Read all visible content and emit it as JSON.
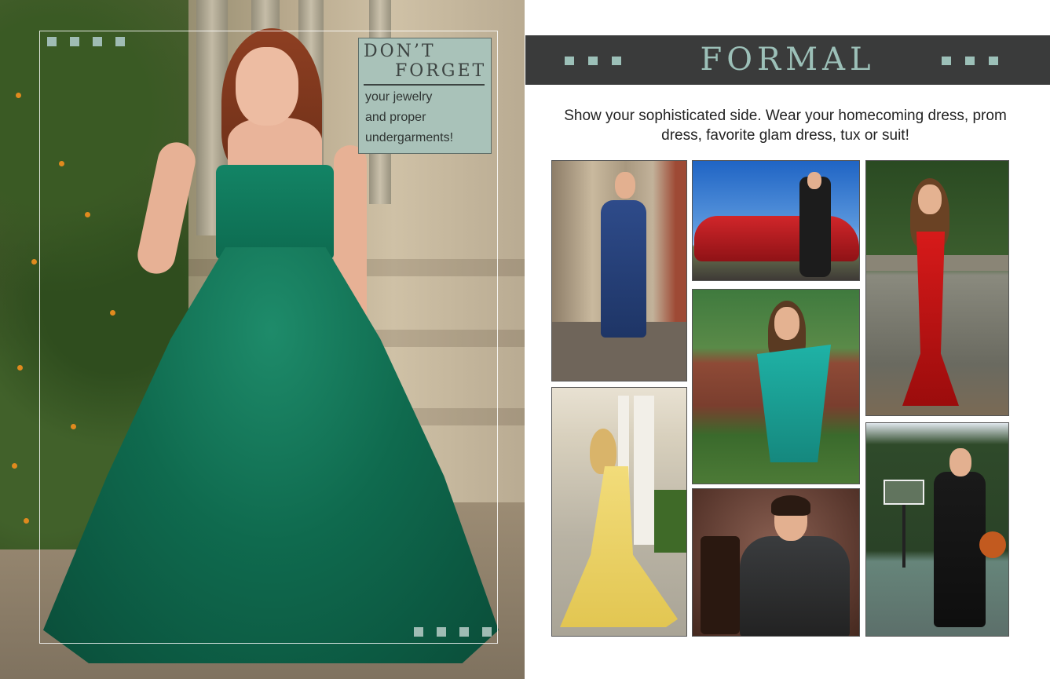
{
  "left_page": {
    "note": {
      "title_line1": "DON’T",
      "title_line2": "FORGET",
      "body_line1": "your jewelry",
      "body_line2": "and proper",
      "body_line3": "undergarments!"
    }
  },
  "right_page": {
    "banner_title": "FORMAL",
    "tagline_line1": "Show your sophisticated side.  Wear your homecoming dress, prom",
    "tagline_line2": "dress, favorite glam dress, tux or suit!"
  },
  "colors": {
    "accent": "#9cc0b8",
    "banner_bg": "#3a3b3b",
    "note_bg": "#a9c2b9"
  }
}
